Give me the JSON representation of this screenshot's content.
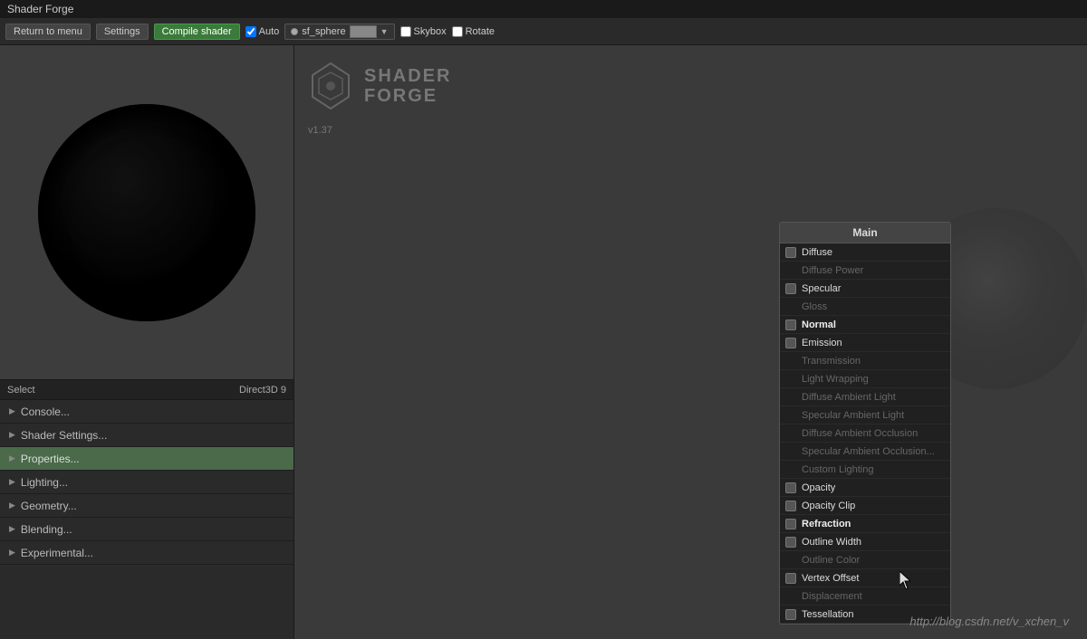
{
  "titleBar": {
    "label": "Shader Forge"
  },
  "toolbar": {
    "returnLabel": "Return to menu",
    "settingsLabel": "Settings",
    "compileLabel": "Compile shader",
    "autoLabel": "Auto",
    "skyboxLabel": "Skybox",
    "rotateLabel": "Rotate"
  },
  "objectSelector": {
    "name": "sf_sphere"
  },
  "preview": {
    "selectLabel": "Select",
    "renderLabel": "Direct3D 9"
  },
  "leftMenu": {
    "items": [
      {
        "label": "Console...",
        "active": false
      },
      {
        "label": "Shader Settings...",
        "active": false
      },
      {
        "label": "Properties...",
        "active": true
      },
      {
        "label": "Lighting...",
        "active": false
      },
      {
        "label": "Geometry...",
        "active": false
      },
      {
        "label": "Blending...",
        "active": false
      },
      {
        "label": "Experimental...",
        "active": false
      }
    ]
  },
  "logo": {
    "line1": "SHADER",
    "line2": "FORGE",
    "version": "v1.37"
  },
  "mainNode": {
    "header": "Main",
    "rows": [
      {
        "label": "Diffuse",
        "dimmed": false
      },
      {
        "label": "Diffuse Power",
        "dimmed": true
      },
      {
        "label": "Specular",
        "dimmed": false
      },
      {
        "label": "Gloss",
        "dimmed": true
      },
      {
        "label": "Normal",
        "dimmed": false,
        "highlight": true
      },
      {
        "label": "Emission",
        "dimmed": false
      },
      {
        "label": "Transmission",
        "dimmed": true
      },
      {
        "label": "Light Wrapping",
        "dimmed": true
      },
      {
        "label": "Diffuse Ambient Light",
        "dimmed": true
      },
      {
        "label": "Specular Ambient Light",
        "dimmed": true
      },
      {
        "label": "Diffuse Ambient Occlusion",
        "dimmed": true
      },
      {
        "label": "Specular Ambient Occlusion...",
        "dimmed": true
      },
      {
        "label": "Custom Lighting",
        "dimmed": true
      },
      {
        "label": "Opacity",
        "dimmed": false
      },
      {
        "label": "Opacity Clip",
        "dimmed": false
      },
      {
        "label": "Refraction",
        "dimmed": false,
        "highlight": true
      },
      {
        "label": "Outline Width",
        "dimmed": false
      },
      {
        "label": "Outline Color",
        "dimmed": true
      },
      {
        "label": "Vertex Offset",
        "dimmed": false
      },
      {
        "label": "Displacement",
        "dimmed": true
      },
      {
        "label": "Tessellation",
        "dimmed": false
      }
    ]
  },
  "footer": {
    "link": "http://blog.csdn.net/v_xchen_v"
  }
}
